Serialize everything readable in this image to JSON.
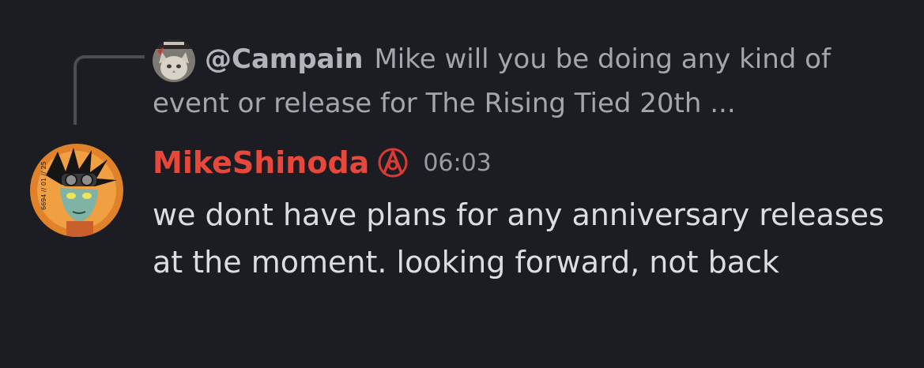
{
  "reply": {
    "author": "@Campain",
    "preview_first": "Mike will you be doing any kind of",
    "preview_second": "event or release for The Rising Tied 20th ...",
    "avatar_icon": "cat-avatar-icon"
  },
  "message": {
    "author": "MikeShinoda",
    "author_color": "#e8473c",
    "badge_icon": "role-badge-icon",
    "timestamp": "06:03",
    "text": "we dont have plans for any anniversary releases at the moment. looking forward, not back",
    "avatar_icon": "illustrated-character-avatar-icon"
  },
  "colors": {
    "background": "#1c1d22",
    "reply_text": "#a4a6ae",
    "message_text": "#dcdde2",
    "timestamp": "#9a9ca4"
  }
}
